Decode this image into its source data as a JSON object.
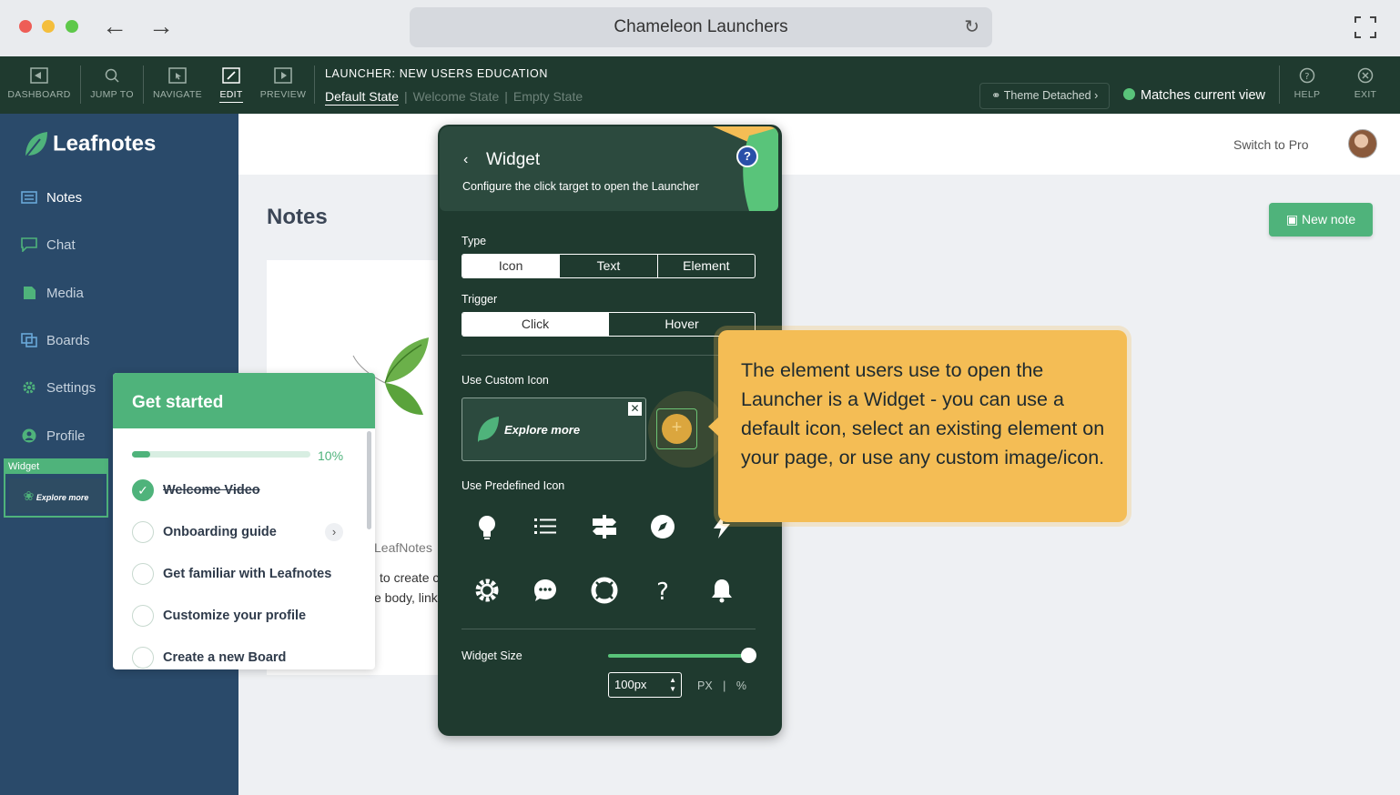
{
  "browser": {
    "url_title": "Chameleon Launchers"
  },
  "toolbar": {
    "tools": [
      "DASHBOARD",
      "JUMP TO",
      "NAVIGATE",
      "EDIT",
      "PREVIEW",
      "HELP",
      "EXIT"
    ],
    "launcher_title": "LAUNCHER: NEW USERS EDUCATION",
    "states": [
      "Default State",
      "Welcome State",
      "Empty State"
    ],
    "theme_button": "Theme Detached",
    "match_status": "Matches current view",
    "status_color": "#59c47a"
  },
  "app": {
    "logo": "Leafnotes",
    "sidebar": [
      "Notes",
      "Chat",
      "Media",
      "Boards",
      "Settings",
      "Profile"
    ],
    "switch_pro": "Switch to Pro",
    "page_title": "Notes",
    "new_note": "New note",
    "card_lines": [
      "LeafNotes",
      "to create c",
      "e body, link"
    ],
    "accent_color": "#4fb37b"
  },
  "widget_box": {
    "tag": "Widget",
    "label": "Explore more"
  },
  "checklist": {
    "title": "Get started",
    "progress_pct": "10%",
    "progress_value": 0.1,
    "items": [
      {
        "label": "Welcome Video",
        "done": true
      },
      {
        "label": "Onboarding guide",
        "done": false
      },
      {
        "label": "Get familiar with Leafnotes",
        "done": false
      },
      {
        "label": "Customize your profile",
        "done": false
      },
      {
        "label": "Create a new Board",
        "done": false
      }
    ]
  },
  "panel": {
    "title": "Widget",
    "subtitle": "Configure the click target to open the Launcher",
    "help": "?",
    "type_label": "Type",
    "type_options": [
      "Icon",
      "Text",
      "Element"
    ],
    "trigger_label": "Trigger",
    "trigger_options": [
      "Click",
      "Hover"
    ],
    "custom_icon_label": "Use Custom Icon",
    "custom_icon_text": "Explore more",
    "predefined_label": "Use Predefined Icon",
    "predefined_icons": [
      "lightbulb-icon",
      "list-icon",
      "signpost-icon",
      "compass-icon",
      "lightning-icon",
      "gear-icon",
      "chat-icon",
      "lifebuoy-icon",
      "question-icon",
      "bell-icon"
    ],
    "size_label": "Widget Size",
    "size_value": "100px",
    "size_fraction": 1.0,
    "unit_px": "PX",
    "unit_pct": "%"
  },
  "tooltip": {
    "text": "The element users use to open the Launcher is a Widget - you can use a default icon, select an existing element on your page, or use any custom image/icon."
  }
}
